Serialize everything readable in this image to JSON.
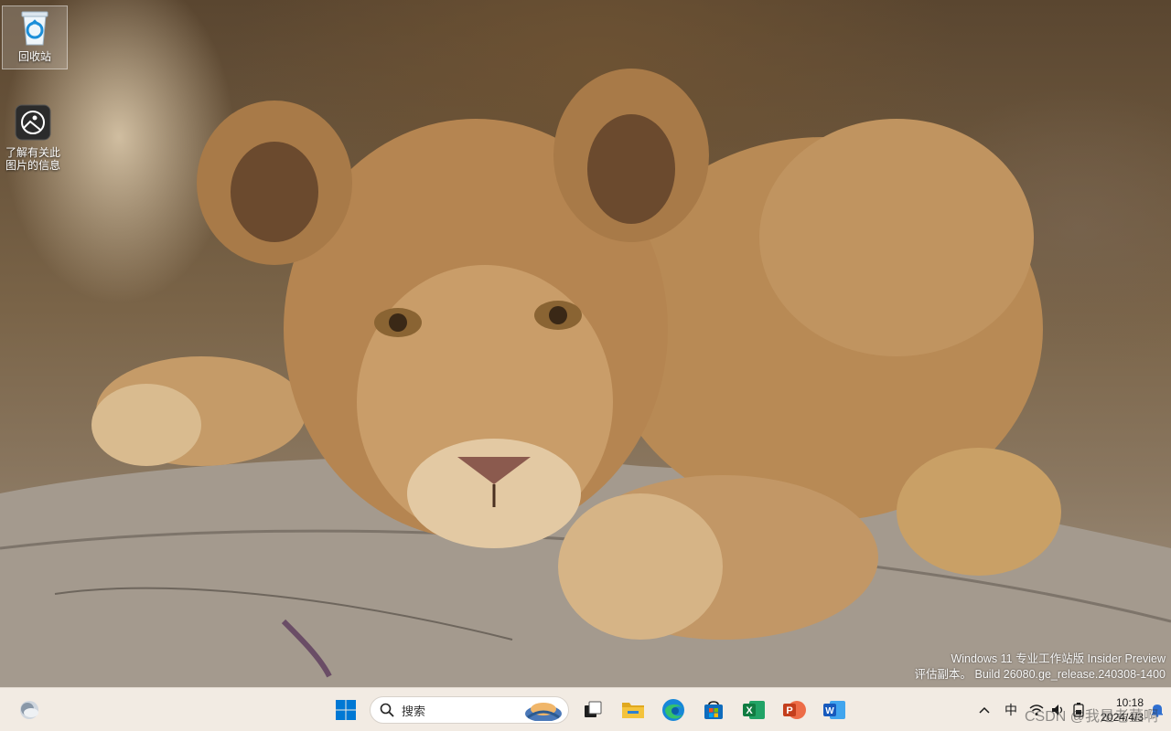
{
  "desktop": {
    "icons": [
      {
        "label": "回收站",
        "icon": "recycle-bin-icon"
      },
      {
        "label": "了解有关此\n图片的信息",
        "icon": "learn-about-picture-icon"
      }
    ]
  },
  "watermark": {
    "line1": "Windows 11 专业工作站版 Insider Preview",
    "line2": "评估副本。 Build 26080.ge_release.240308-1400"
  },
  "taskbar": {
    "search_placeholder": "搜索",
    "apps": [
      {
        "name": "start-button",
        "icon": "windows-logo-icon"
      },
      {
        "name": "task-view-button",
        "icon": "task-view-icon"
      },
      {
        "name": "file-explorer",
        "icon": "folder-icon"
      },
      {
        "name": "edge",
        "icon": "edge-icon"
      },
      {
        "name": "microsoft-store",
        "icon": "store-icon"
      },
      {
        "name": "excel",
        "icon": "excel-icon",
        "letter": "X"
      },
      {
        "name": "powerpoint",
        "icon": "powerpoint-icon",
        "letter": "P"
      },
      {
        "name": "word",
        "icon": "word-icon",
        "letter": "W"
      }
    ],
    "tray": {
      "ime": "中",
      "time": "10:18",
      "date": "2024/4/3",
      "overlay_text": "CSDN @我是老董啊"
    }
  },
  "colors": {
    "taskbar_bg": "#f2ebe3",
    "start_blue": "#0078d4",
    "excel_green": "#107c41",
    "ppt_red": "#c43e1c",
    "word_blue": "#185abd",
    "folder_yellow": "#f4c33c"
  }
}
